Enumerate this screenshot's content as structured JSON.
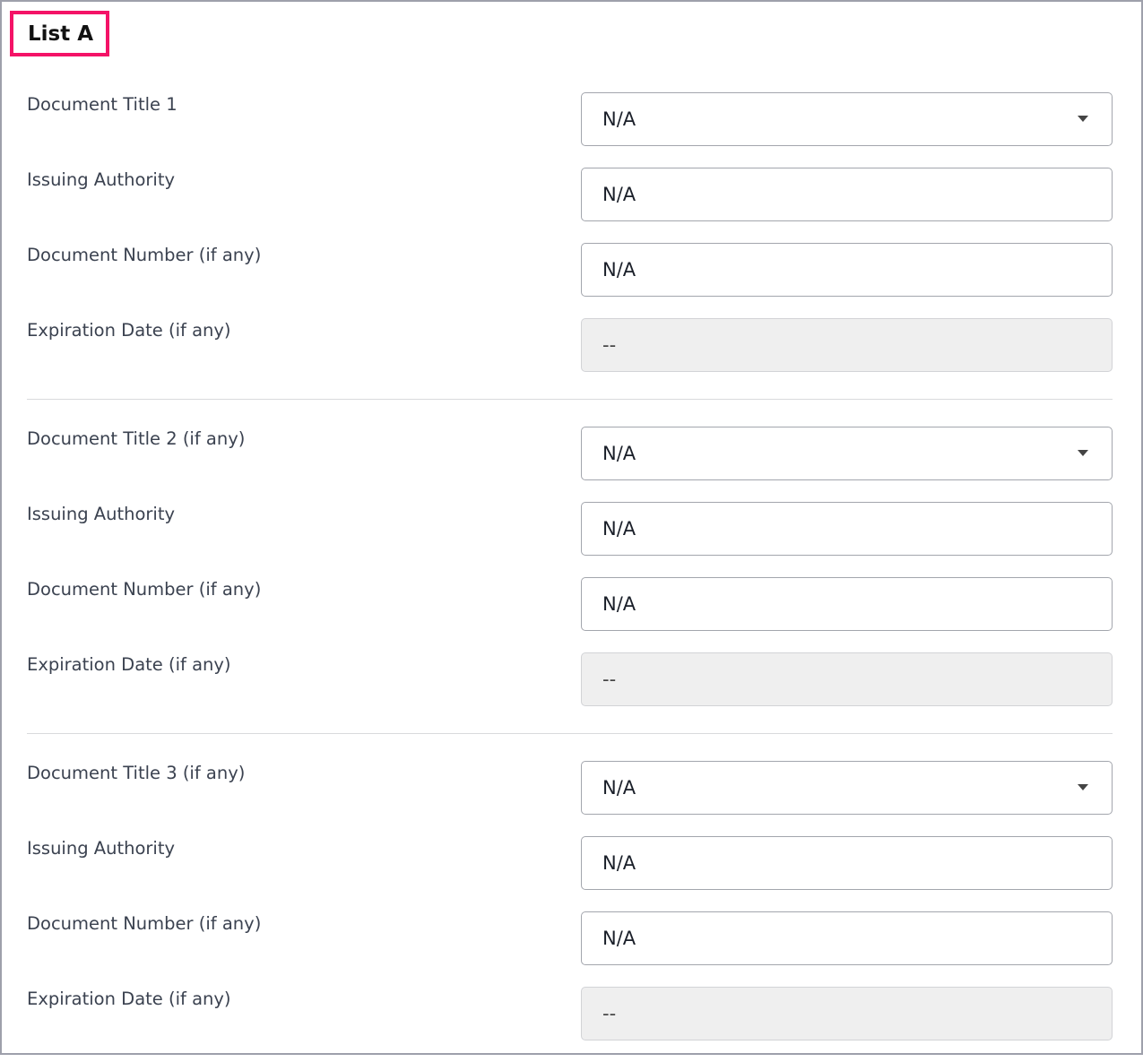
{
  "title": "List A",
  "documents": [
    {
      "title_label": "Document Title 1",
      "title_value": "N/A",
      "authority_label": "Issuing Authority",
      "authority_value": "N/A",
      "number_label": "Document Number (if any)",
      "number_value": "N/A",
      "expiration_label": "Expiration Date (if any)",
      "expiration_value": "--"
    },
    {
      "title_label": "Document Title 2 (if any)",
      "title_value": "N/A",
      "authority_label": "Issuing Authority",
      "authority_value": "N/A",
      "number_label": "Document Number (if any)",
      "number_value": "N/A",
      "expiration_label": "Expiration Date (if any)",
      "expiration_value": "--"
    },
    {
      "title_label": "Document Title 3 (if any)",
      "title_value": "N/A",
      "authority_label": "Issuing Authority",
      "authority_value": "N/A",
      "number_label": "Document Number (if any)",
      "number_value": "N/A",
      "expiration_label": "Expiration Date (if any)",
      "expiration_value": "--"
    }
  ],
  "colors": {
    "highlight_border": "#f41367",
    "frame_border": "#9ea0ab",
    "disabled_background": "#efefef"
  },
  "icons": {
    "select_caret": "caret-down-icon"
  }
}
